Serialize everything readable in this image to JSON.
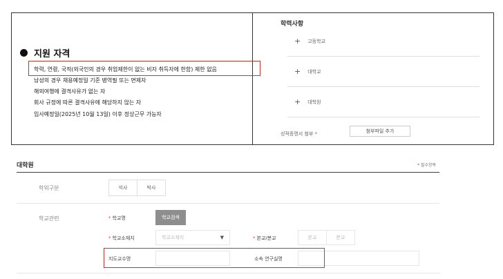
{
  "qualification": {
    "title": "지원 자격",
    "lines": [
      "학력, 연령, 국적(외국인의 경우 취업제한이 없는 비자 취득자에 한함) 제한 없음",
      "남성의 경우 채용예정일 기준 병역필 또는 면제자",
      "해외여행에 결격사유가 없는 자",
      "회사 규정에 따른 결격사유에 해당하지 않는 자",
      "입사예정일(2025년 10월 13일) 이후 정상근무 가능자"
    ]
  },
  "education": {
    "title": "학력사항",
    "items": [
      "고등학교",
      "대학교",
      "대학원"
    ],
    "cert_label": "성적증명서 첨부",
    "cert_required": "*",
    "cert_button": "첨부파일 추가"
  },
  "grad_form": {
    "title": "대학원",
    "required_star": "*",
    "required_note": "필수항목",
    "degree": {
      "label": "학위구분",
      "options": [
        "석사",
        "박사"
      ]
    },
    "school": {
      "label": "학교관련",
      "star": "*",
      "name_label": "학교명",
      "search_button": "학교검색",
      "location_label": "학교소재지",
      "location_placeholder": "학교소재지",
      "campus_label": "본교/분교",
      "campus_options": [
        "본교",
        "분교"
      ],
      "advisor_label": "지도교수명",
      "advisor_value": "",
      "lab_label": "소속 연구실명",
      "lab_value": ""
    }
  },
  "colors": {
    "accent_red": "#c0392b",
    "required_red": "#e53935",
    "title_underline": "#8b1a1a",
    "search_button_bg": "#8e8e8e"
  }
}
